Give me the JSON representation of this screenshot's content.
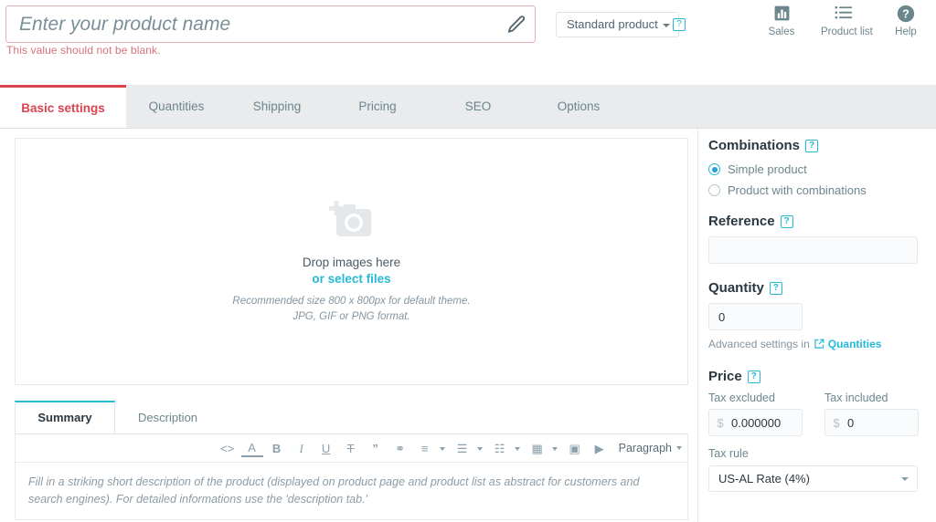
{
  "header": {
    "product_name_value": "",
    "product_name_placeholder": "Enter your product name",
    "edit_icon": "pencil-icon",
    "error_message": "This value should not be blank.",
    "product_type": "Standard product",
    "help_badge": "?",
    "actions": [
      {
        "label": "Sales",
        "icon": "bar-chart-icon"
      },
      {
        "label": "Product list",
        "icon": "list-icon"
      },
      {
        "label": "Help",
        "icon": "question-circle-icon"
      }
    ]
  },
  "tabs": [
    {
      "label": "Basic settings",
      "active": true
    },
    {
      "label": "Quantities",
      "active": false
    },
    {
      "label": "Shipping",
      "active": false
    },
    {
      "label": "Pricing",
      "active": false
    },
    {
      "label": "SEO",
      "active": false
    },
    {
      "label": "Options",
      "active": false
    }
  ],
  "dropzone": {
    "icon": "camera-plus-icon",
    "title": "Drop images here",
    "link": "or select files",
    "note_line1": "Recommended size 800 x 800px for default theme.",
    "note_line2": "JPG, GIF or PNG format."
  },
  "editor": {
    "tabs": [
      {
        "label": "Summary",
        "active": true
      },
      {
        "label": "Description",
        "active": false
      }
    ],
    "toolbar": [
      {
        "name": "source-code-icon",
        "glyph": "<>"
      },
      {
        "name": "text-color-icon",
        "glyph": "A"
      },
      {
        "name": "bold-icon",
        "glyph": "B"
      },
      {
        "name": "italic-icon",
        "glyph": "I"
      },
      {
        "name": "underline-icon",
        "glyph": "U"
      },
      {
        "name": "strikethrough-icon",
        "glyph": "T"
      },
      {
        "name": "blockquote-icon",
        "glyph": "”"
      },
      {
        "name": "link-icon",
        "glyph": "⚭"
      },
      {
        "name": "align-icon",
        "glyph": "≡"
      },
      {
        "name": "bullet-list-icon",
        "glyph": "☰"
      },
      {
        "name": "numbered-list-icon",
        "glyph": "☷"
      },
      {
        "name": "table-icon",
        "glyph": "▦"
      },
      {
        "name": "image-icon",
        "glyph": "▣"
      },
      {
        "name": "video-icon",
        "glyph": "▶"
      }
    ],
    "paragraph_label": "Paragraph",
    "placeholder": "Fill in a striking short description of the product (displayed on product page and product list as abstract for customers and search engines). For detailed informations use the 'description tab.'"
  },
  "sidebar": {
    "combinations": {
      "title": "Combinations",
      "help_badge": "?",
      "options": [
        {
          "label": "Simple product",
          "selected": true
        },
        {
          "label": "Product with combinations",
          "selected": false
        }
      ]
    },
    "reference": {
      "title": "Reference",
      "help_badge": "?",
      "value": ""
    },
    "quantity": {
      "title": "Quantity",
      "help_badge": "?",
      "value": "0",
      "advanced_text": "Advanced settings in",
      "advanced_link": "Quantities",
      "advanced_link_icon": "external-link-icon"
    },
    "price": {
      "title": "Price",
      "help_badge": "?",
      "tax_excluded_label": "Tax excluded",
      "tax_excluded_currency": "$",
      "tax_excluded_value": "0.000000",
      "tax_included_label": "Tax included",
      "tax_included_currency": "$",
      "tax_included_value": "0",
      "tax_rule_label": "Tax rule",
      "tax_rule_value": "US-AL Rate (4%)"
    }
  },
  "colors": {
    "accent_cyan": "#25b9d7",
    "error_red": "#d9444f",
    "tabbar_bg": "#e9ebec",
    "text_muted": "#6c868e"
  }
}
